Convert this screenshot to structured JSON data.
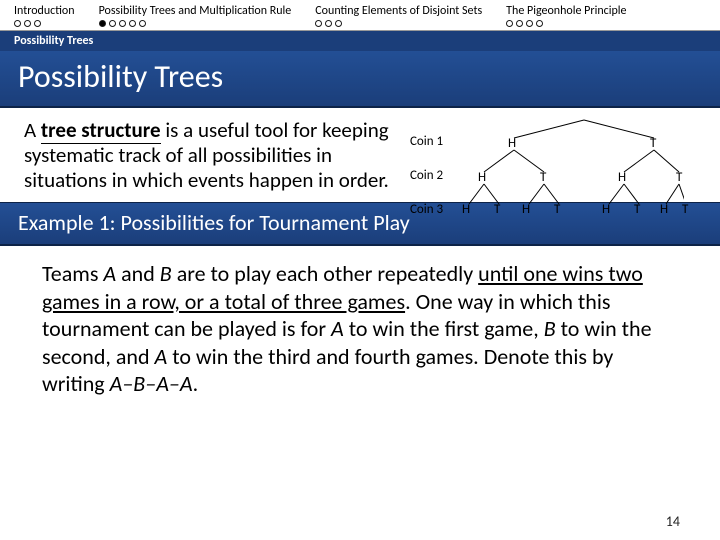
{
  "nav": {
    "sections": [
      {
        "title": "Introduction",
        "dots": 3,
        "filled": 0
      },
      {
        "title": "Possibility Trees and Multiplication Rule",
        "dots": 5,
        "filled": 1
      },
      {
        "title": "Counting Elements of Disjoint Sets",
        "dots": 3,
        "filled": 0
      },
      {
        "title": "The Pigeonhole Principle",
        "dots": 4,
        "filled": 0
      }
    ]
  },
  "breadcrumb": "Possibility Trees",
  "title": "Possibility Trees",
  "intro": {
    "lead": "tree structure",
    "before": "A ",
    "after": " is a useful tool for keeping systematic track of all possibilities in situations in which events happen in order."
  },
  "coins": {
    "c1": "Coin 1",
    "c2": "Coin 2",
    "c3": "Coin 3"
  },
  "tree": {
    "l1": [
      "H",
      "T"
    ],
    "l2": [
      "H",
      "T",
      "H",
      "T"
    ],
    "l3": [
      "H",
      "T",
      "H",
      "T",
      "H",
      "T",
      "H",
      "T"
    ]
  },
  "subhead": "Example 1: Possibilities for Tournament Play",
  "para": {
    "p1a": "Teams ",
    "A": "A",
    "p1b": " and ",
    "B": "B",
    "p1c": " are to play each other repeatedly ",
    "p1d": "until one wins two games in a row, or a total of three games",
    "p1e": ". One way in which this tournament can be played is for ",
    "p1f": " to win the first game, ",
    "p1g": " to win the second, and ",
    "p1h": " to win the third and fourth games. Denote this by writing ",
    "seq": "A–B–A–A",
    "dot": "."
  },
  "pagenum": "14"
}
